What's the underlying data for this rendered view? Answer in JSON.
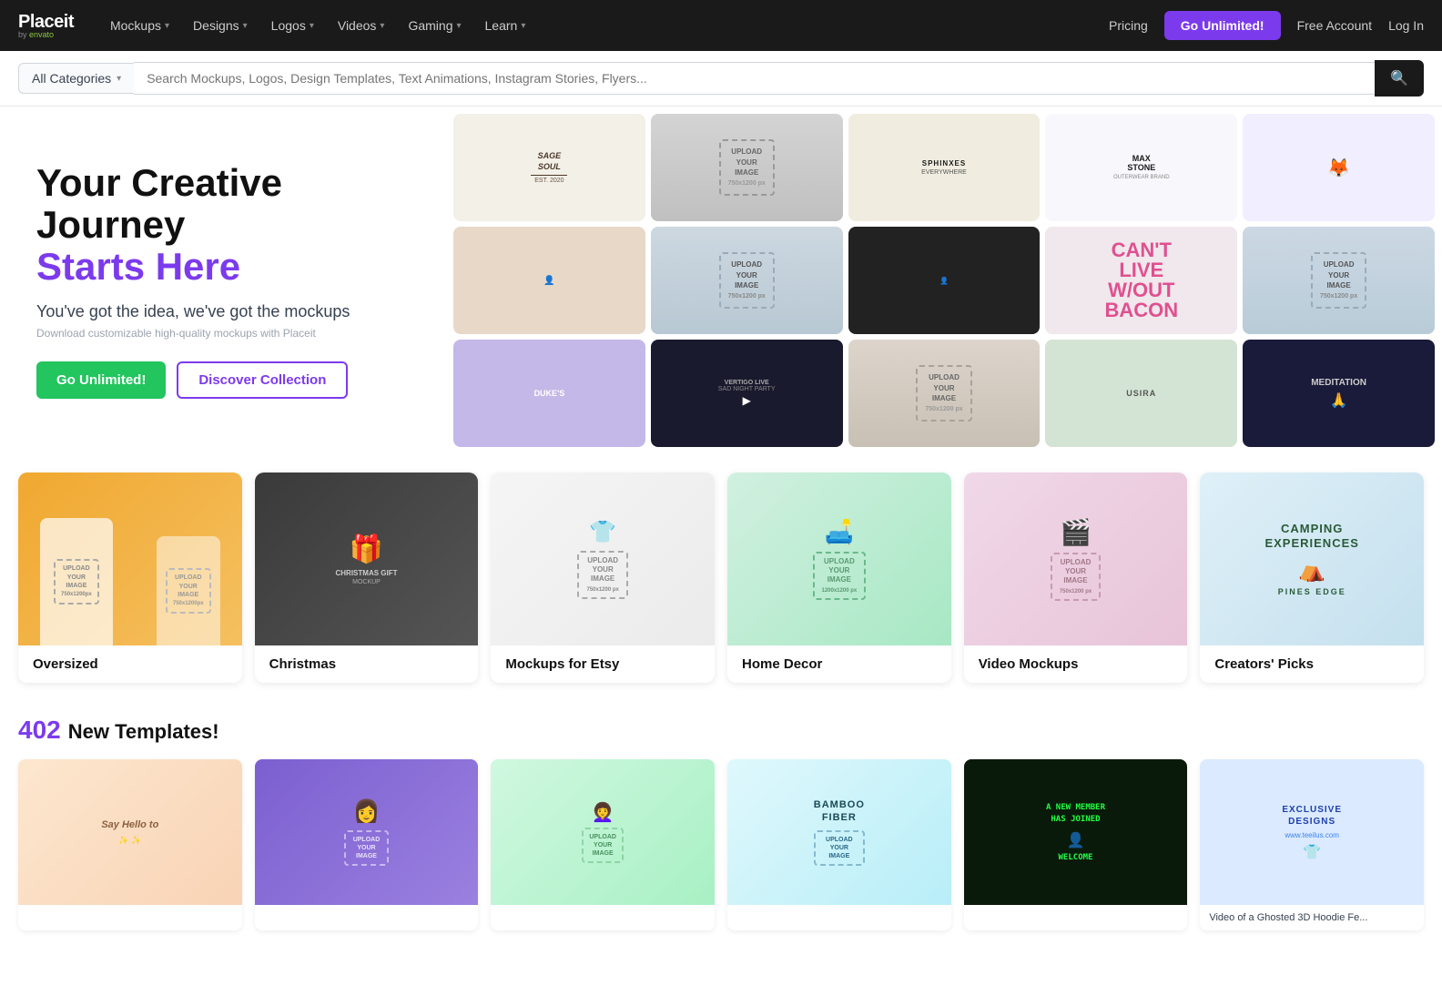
{
  "nav": {
    "logo": "Placeit",
    "logo_by": "by",
    "logo_envato": "envato",
    "items": [
      {
        "label": "Mockups",
        "has_dropdown": true
      },
      {
        "label": "Designs",
        "has_dropdown": true
      },
      {
        "label": "Logos",
        "has_dropdown": true
      },
      {
        "label": "Videos",
        "has_dropdown": true
      },
      {
        "label": "Gaming",
        "has_dropdown": true
      },
      {
        "label": "Learn",
        "has_dropdown": true
      }
    ],
    "pricing": "Pricing",
    "unlimited": "Go Unlimited!",
    "free_account": "Free Account",
    "login": "Log In"
  },
  "search": {
    "category_label": "All Categories",
    "placeholder": "Search Mockups, Logos, Design Templates, Text Animations, Instagram Stories, Flyers..."
  },
  "hero": {
    "title_line1": "Your Creative Journey",
    "title_line2": "Starts Here",
    "subtitle": "You've got the idea, we've got the mockups",
    "description": "Download customizable high-quality mockups with Placeit",
    "btn_unlimited": "Go Unlimited!",
    "btn_discover": "Discover Collection"
  },
  "categories": [
    {
      "id": "oversized",
      "label": "Oversized"
    },
    {
      "id": "christmas",
      "label": "Christmas"
    },
    {
      "id": "etsy",
      "label": "Mockups for Etsy"
    },
    {
      "id": "homedecor",
      "label": "Home Decor"
    },
    {
      "id": "video",
      "label": "Video Mockups"
    },
    {
      "id": "creators",
      "label": "Creators' Picks"
    }
  ],
  "new_templates": {
    "count": "402",
    "label": "New Templates!",
    "items": [
      {
        "id": "t1",
        "label": ""
      },
      {
        "id": "t2",
        "label": ""
      },
      {
        "id": "t3",
        "label": ""
      },
      {
        "id": "t4",
        "label": ""
      },
      {
        "id": "t5",
        "label": ""
      },
      {
        "id": "t6",
        "label": "Video of a Ghosted 3D Hoodie Fe..."
      }
    ]
  },
  "upload_text": "UPLOAD YOUR IMAGE",
  "upload_dim_750": "750x1200 px",
  "upload_dim_1200": "1200x1200 px"
}
